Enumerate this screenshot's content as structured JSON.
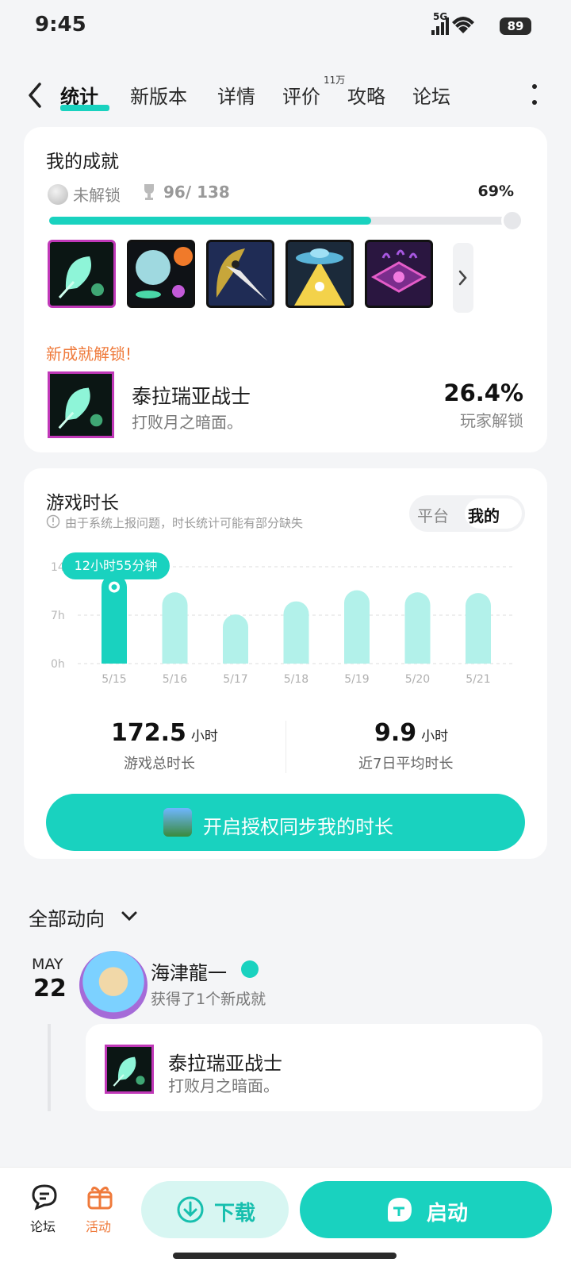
{
  "status_bar": {
    "time": "9:45",
    "network": "5G",
    "battery": "89"
  },
  "nav": {
    "tabs": [
      "统计",
      "新版本",
      "详情",
      "评价",
      "攻略",
      "论坛"
    ],
    "review_badge": "11万"
  },
  "achievements": {
    "title": "我的成就",
    "locked_label": "未解锁",
    "count": "96/ 138",
    "percent": "69%",
    "progress_fraction": 0.69,
    "new_label": "新成就解锁!",
    "latest": {
      "name": "泰拉瑞亚战士",
      "desc": "打败月之暗面。",
      "rate": "26.4%",
      "rate_label": "玩家解锁"
    },
    "icons": [
      "leaf-icon",
      "planet-icon",
      "plague-doctor-icon",
      "ufo-icon",
      "eye-icon"
    ]
  },
  "playtime": {
    "title": "游戏时长",
    "notice": "由于系统上报问题，时长统计可能有部分缺失",
    "toggle": [
      "平台",
      "我的"
    ],
    "tooltip": "12小时55分钟",
    "total_value": "172.5",
    "total_unit": "小时",
    "total_label": "游戏总时长",
    "avg_value": "9.9",
    "avg_unit": "小时",
    "avg_label": "近7日平均时长",
    "sync_label": "开启授权同步我的时长"
  },
  "chart_data": {
    "type": "bar",
    "categories": [
      "5/15",
      "5/16",
      "5/17",
      "5/18",
      "5/19",
      "5/20",
      "5/21"
    ],
    "values": [
      12.9,
      10.3,
      7.1,
      9.0,
      10.6,
      10.3,
      10.2
    ],
    "yticks": [
      "0h",
      "7h",
      "14h"
    ],
    "ylim": [
      0,
      14
    ],
    "highlight_index": 0,
    "colors": {
      "highlight": "#19d2bf",
      "normal": "#b2f1ea"
    }
  },
  "feed": {
    "title": "全部动向",
    "month": "MAY",
    "day": "22",
    "user": "海津龍一",
    "action": "获得了1个新成就",
    "ach_name": "泰拉瑞亚战士",
    "ach_desc": "打败月之暗面。"
  },
  "bottom_bar": {
    "forum": "论坛",
    "activity": "活动",
    "download": "下载",
    "launch": "启动"
  },
  "colors": {
    "accent": "#19d2bf",
    "orange": "#ef7a3b"
  }
}
